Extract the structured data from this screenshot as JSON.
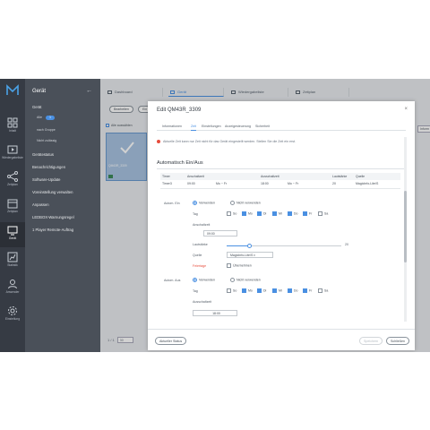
{
  "rail": [
    {
      "label": "Inhalt",
      "icon": "content-icon"
    },
    {
      "label": "Wiedergabeliste",
      "icon": "playlist-icon"
    },
    {
      "label": "Zeitplan",
      "icon": "schedule-icon"
    },
    {
      "label": "Gerät",
      "icon": "device-icon"
    },
    {
      "label": "Statistik",
      "icon": "statistics-icon"
    },
    {
      "label": "Anwender",
      "icon": "user-icon"
    },
    {
      "label": "Einstellung",
      "icon": "settings-icon"
    }
  ],
  "menu": {
    "title": "Gerät",
    "items": [
      {
        "label": "Gerät",
        "sub": false
      },
      {
        "label": "Alle",
        "sub": true,
        "badge": "1"
      },
      {
        "label": "nach Gruppe",
        "sub": true
      },
      {
        "label": "Nicht zulässig",
        "sub": true
      },
      {
        "label": "Gerätestatus",
        "sub": false
      },
      {
        "label": "Benachrichtigungen",
        "sub": false
      },
      {
        "label": "Software-Update",
        "sub": false
      },
      {
        "label": "Voreinstellung verwalten",
        "sub": false
      },
      {
        "label": "Anpassen",
        "sub": false
      },
      {
        "label": "LEDBOX-Warnungsregel",
        "sub": false
      },
      {
        "label": "1 Player Remote-Auftrag",
        "sub": false
      }
    ]
  },
  "tabs": [
    "Dashboard",
    "Gerät",
    "Wiedergabeliste",
    "Zeitplan"
  ],
  "toolbar": {
    "edit": "Bearbeiten",
    "second": "Ein"
  },
  "list": {
    "select_all": "Alle auswählen",
    "device_name": "QM43R_3309",
    "right_pill": "Inform"
  },
  "pager": {
    "range": "1 / 1",
    "per_page": "30",
    "page": "1"
  },
  "dialog": {
    "title": "Edit QM43R_3309",
    "tabs": [
      "Informationen",
      "Zeit",
      "Einstellungen",
      "Anzeigesteuerung",
      "Sicherheit"
    ],
    "note": "Aktuelle Zeit kann nur Zeit nicht für das Gerät eingestellt werden. Stellen Sie die Zeit ein erst.",
    "section": "Automatisch Ein/Aus",
    "table": {
      "headers": [
        "Timer",
        "Anschaltzeit",
        "",
        "Ausschaltzeit",
        "",
        "Lautstärke",
        "Quelle"
      ],
      "row": [
        "Timer3",
        "09:00",
        "Mo ~ Fr",
        "18:00",
        "Mo ~ Fr",
        "20",
        "MagicInfo-Lite/S"
      ]
    },
    "on": {
      "label": "Autom. Ein",
      "opt_use": "Verwenden",
      "opt_nouse": "Nicht verwenden",
      "day_label": "Tag",
      "days": [
        {
          "d": "So",
          "on": false
        },
        {
          "d": "Mo",
          "on": true
        },
        {
          "d": "Di",
          "on": true
        },
        {
          "d": "Mi",
          "on": true
        },
        {
          "d": "Do",
          "on": true
        },
        {
          "d": "Fr",
          "on": true
        },
        {
          "d": "Sa",
          "on": false
        }
      ],
      "time_label": "Anschaltzeit",
      "time": "09:00",
      "volume_label": "Lautstärke",
      "volume": "20",
      "volume_fraction": 0.2,
      "source_label": "Quelle",
      "source": "MagicInfo-Lite/S",
      "holiday_label": "Feiertage",
      "holiday_option": "Übernehmen"
    },
    "off": {
      "label": "Autom. Aus",
      "opt_use": "Verwenden",
      "opt_nouse": "Nicht verwenden",
      "day_label": "Tag",
      "days": [
        {
          "d": "So",
          "on": false
        },
        {
          "d": "Mo",
          "on": true
        },
        {
          "d": "Di",
          "on": true
        },
        {
          "d": "Mi",
          "on": true
        },
        {
          "d": "Do",
          "on": true
        },
        {
          "d": "Fr",
          "on": true
        },
        {
          "d": "Sa",
          "on": false
        }
      ],
      "time_label": "Ausschaltzeit",
      "time": "18:00"
    },
    "footer": {
      "refresh": "Aktueller Status",
      "save": "Speichern",
      "close": "Schließen"
    }
  },
  "colors": {
    "accent": "#4a90e2",
    "rail": "#363b44",
    "menu": "#4a5059",
    "warn": "#e74c3c"
  }
}
